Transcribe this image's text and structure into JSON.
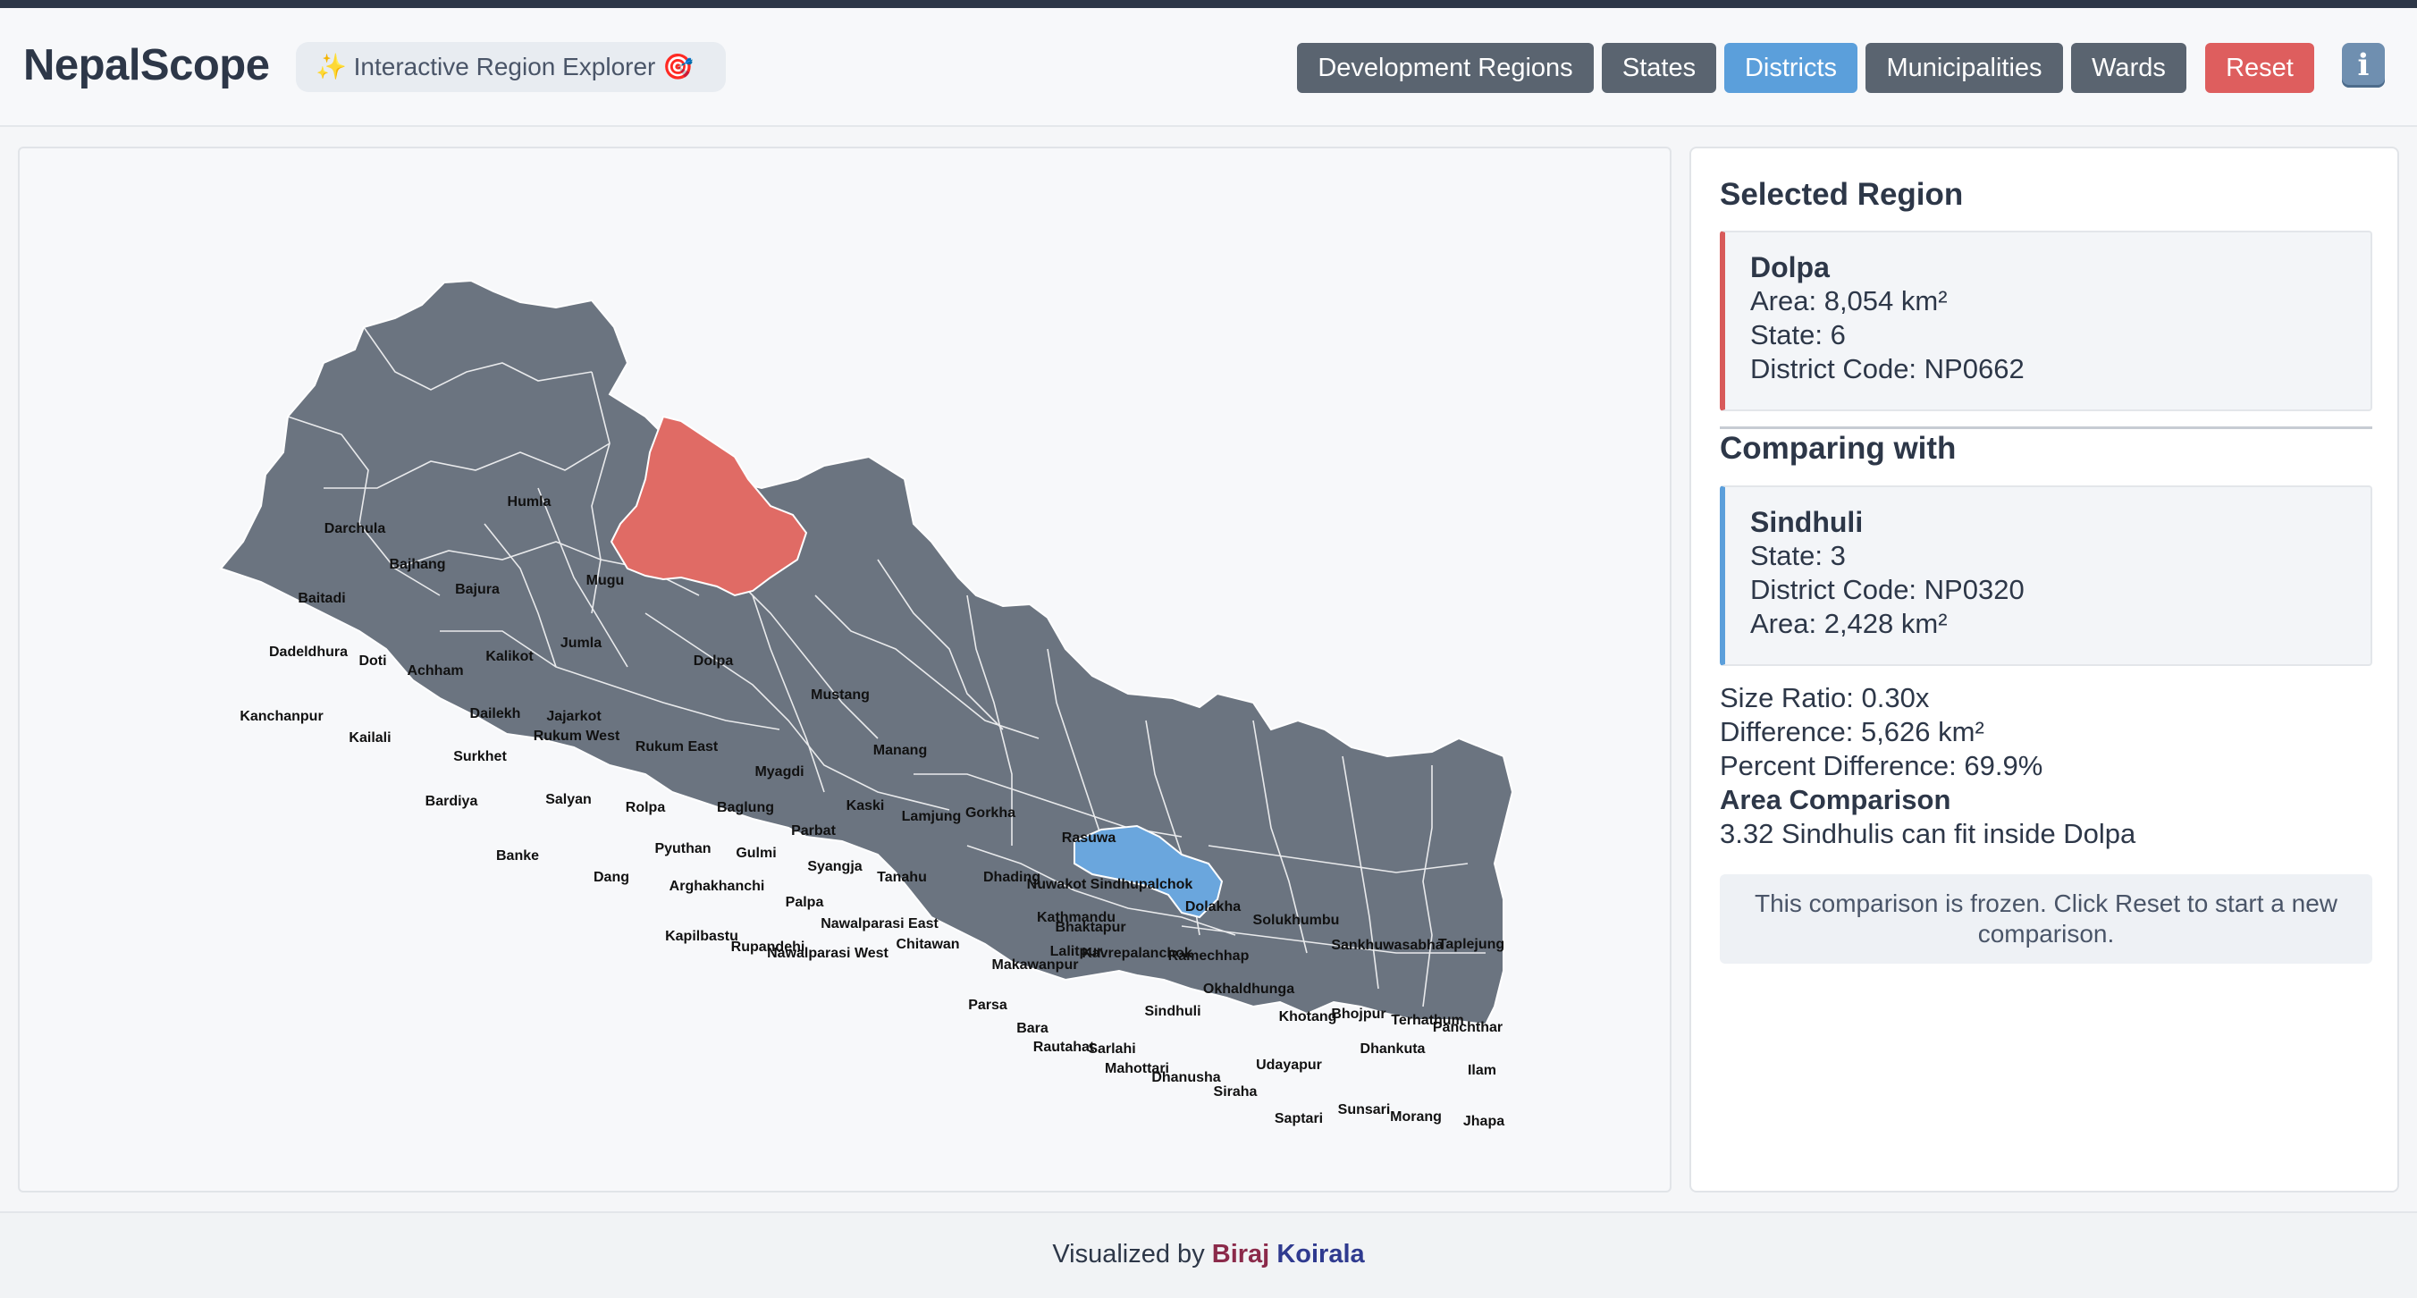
{
  "app": {
    "title": "NepalScope",
    "tagline_spark": "✨",
    "tagline": "Interactive Region Explorer",
    "tagline_target": "🎯"
  },
  "nav": {
    "buttons": [
      {
        "label": "Development Regions",
        "active": false
      },
      {
        "label": "States",
        "active": false
      },
      {
        "label": "Districts",
        "active": true
      },
      {
        "label": "Municipalities",
        "active": false
      },
      {
        "label": "Wards",
        "active": false
      }
    ],
    "reset_label": "Reset",
    "info_icon": "info-icon",
    "info_glyph": "i"
  },
  "map": {
    "colors": {
      "default": "#6b7480",
      "selected": "#e06b65",
      "compared": "#6aa6dd",
      "border": "#ffffff"
    },
    "selected_district": "Dolpa",
    "compared_district": "Sindhuli",
    "labels": [
      "Humla",
      "Darchula",
      "Bajhang",
      "Mugu",
      "Bajura",
      "Baitadi",
      "Jumla",
      "Dadeldhura",
      "Doti",
      "Kalikot",
      "Dolpa",
      "Achham",
      "Mustang",
      "Kanchanpur",
      "Dailekh",
      "Jajarkot",
      "Kailali",
      "Rukum West",
      "Rukum East",
      "Manang",
      "Surkhet",
      "Myagdi",
      "Bardiya",
      "Salyan",
      "Rolpa",
      "Baglung",
      "Kaski",
      "Lamjung",
      "Gorkha",
      "Parbat",
      "Rasuwa",
      "Banke",
      "Pyuthan",
      "Gulmi",
      "Syangja",
      "Dang",
      "Arghakhanchi",
      "Tanahu",
      "Dhading",
      "Nuwakot",
      "Sindhupalchok",
      "Palpa",
      "Dolakha",
      "Kathmandu",
      "Bhaktapur",
      "Solukhumbu",
      "Nawalparasi East",
      "Kapilbastu",
      "Rupandehi",
      "Nawalparasi West",
      "Chitawan",
      "Sankhuwasabha",
      "Taplejung",
      "Lalitpur",
      "Kavrepalanchok",
      "Ramechhap",
      "Makawanpur",
      "Okhaldhunga",
      "Parsa",
      "Sindhuli",
      "Khotang",
      "Bhojpur",
      "Terhathum",
      "Panchthar",
      "Bara",
      "Rautahat",
      "Sarlahi",
      "Dhankuta",
      "Mahottari",
      "Dhanusha",
      "Udayapur",
      "Ilam",
      "Siraha",
      "Sunsari",
      "Morang",
      "Saptari",
      "Jhapa"
    ]
  },
  "selected": {
    "heading": "Selected Region",
    "name": "Dolpa",
    "area": "Area: 8,054 km²",
    "state": "State: 6",
    "code": "District Code: NP0662"
  },
  "comparing": {
    "heading": "Comparing with",
    "name": "Sindhuli",
    "state": "State: 3",
    "code": "District Code: NP0320",
    "area": "Area: 2,428 km²"
  },
  "stats": {
    "ratio": "Size Ratio: 0.30x",
    "difference": "Difference: 5,626 km²",
    "percent": "Percent Difference: 69.9%",
    "comparison_title": "Area Comparison",
    "comparison_text": "3.32 Sindhulis can fit inside Dolpa"
  },
  "note": "This comparison is frozen. Click Reset to start a new comparison.",
  "footer": {
    "prefix": "Visualized by",
    "author_first": "Biraj",
    "author_last": "Koirala"
  }
}
